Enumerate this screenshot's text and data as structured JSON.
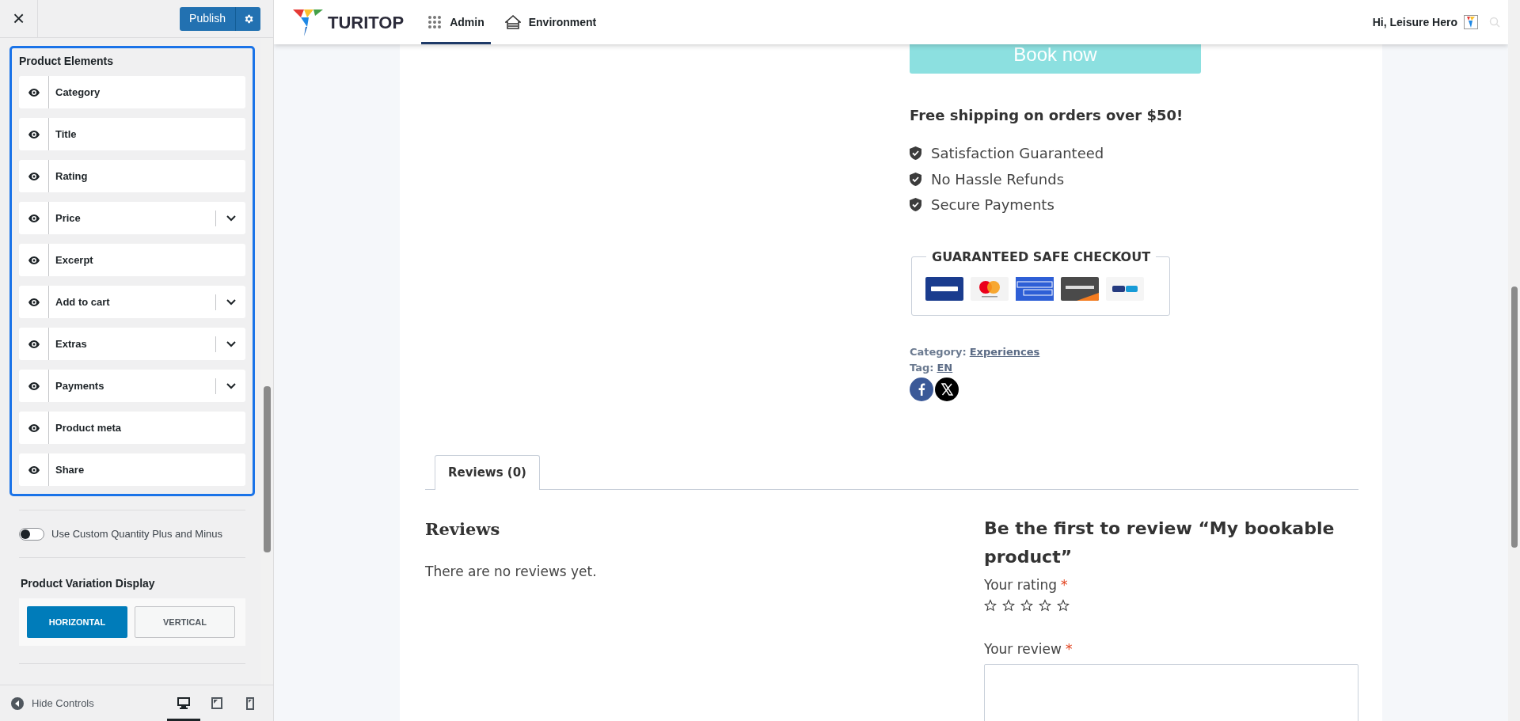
{
  "panel": {
    "close": "×",
    "publish": "Publish",
    "section_title": "Product Elements",
    "elements": [
      {
        "label": "Category",
        "visible": true,
        "expandable": false
      },
      {
        "label": "Title",
        "visible": true,
        "expandable": false
      },
      {
        "label": "Rating",
        "visible": true,
        "expandable": false
      },
      {
        "label": "Price",
        "visible": true,
        "expandable": true
      },
      {
        "label": "Excerpt",
        "visible": true,
        "expandable": false
      },
      {
        "label": "Add to cart",
        "visible": true,
        "expandable": true
      },
      {
        "label": "Extras",
        "visible": true,
        "expandable": true
      },
      {
        "label": "Payments",
        "visible": true,
        "expandable": true
      },
      {
        "label": "Product meta",
        "visible": true,
        "expandable": false
      },
      {
        "label": "Share",
        "visible": true,
        "expandable": false
      }
    ],
    "toggle": {
      "label": "Use Custom Quantity Plus and Minus",
      "on": false
    },
    "variation_title": "Product Variation Display",
    "variation_options": [
      {
        "label": "HORIZONTAL",
        "selected": true
      },
      {
        "label": "VERTICAL",
        "selected": false
      }
    ],
    "hide_controls": "Hide Controls",
    "devices": [
      {
        "kind": "desktop",
        "selected": true
      },
      {
        "kind": "tablet",
        "selected": false
      },
      {
        "kind": "mobile",
        "selected": false
      }
    ]
  },
  "header": {
    "logo": "TURITOP",
    "nav": [
      {
        "label": "Admin",
        "selected": true
      },
      {
        "label": "Environment",
        "selected": false
      }
    ],
    "greeting": "Hi, Leisure Hero"
  },
  "product": {
    "book_button": "Book now",
    "shipping": "Free shipping on orders over $50!",
    "guarantees": [
      "Satisfaction Guaranteed",
      "No Hassle Refunds",
      "Secure Payments"
    ],
    "checkout_title": "GUARANTEED SAFE CHECKOUT",
    "cards": [
      {
        "kind": "visa"
      },
      {
        "kind": "mastercard"
      },
      {
        "kind": "amex"
      },
      {
        "kind": "discover"
      },
      {
        "kind": "paypal"
      }
    ],
    "meta": [
      {
        "label": "Category:",
        "value": "Experiences"
      },
      {
        "label": "Tag:",
        "value": "EN"
      }
    ],
    "share": [
      {
        "kind": "facebook"
      },
      {
        "kind": "x"
      }
    ]
  },
  "tabs": [
    {
      "label": "Reviews (0)",
      "selected": true
    }
  ],
  "reviews": {
    "title": "Reviews",
    "empty": "There are no reviews yet.",
    "form_title": "Be the first to review “My bookable product”",
    "rating_label": "Your rating",
    "required": "*",
    "stars": 0,
    "review_label": "Your review",
    "review_required": "*"
  }
}
